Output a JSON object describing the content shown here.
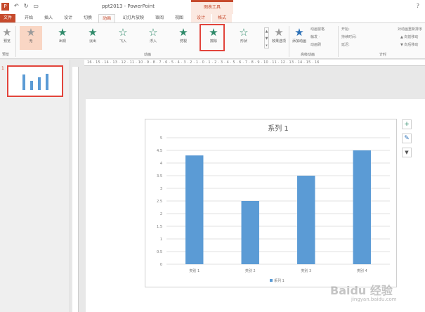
{
  "titlebar": {
    "window_title": "ppt2013 - PowerPoint",
    "context_header": "图表工具",
    "help": "?",
    "qat": {
      "app": "P",
      "undo": "↶",
      "redo": "↻",
      "present": "▭"
    }
  },
  "tabs": [
    {
      "label": "文件"
    },
    {
      "label": "开始"
    },
    {
      "label": "插入"
    },
    {
      "label": "设计"
    },
    {
      "label": "切换"
    },
    {
      "label": "动画"
    },
    {
      "label": "幻灯片放映"
    },
    {
      "label": "审阅"
    },
    {
      "label": "视图"
    },
    {
      "label": "设计"
    },
    {
      "label": "格式"
    }
  ],
  "ribbon": {
    "preview": {
      "label": "预览",
      "group": "预览"
    },
    "animations": [
      {
        "label": "无"
      },
      {
        "label": "出现"
      },
      {
        "label": "淡出"
      },
      {
        "label": "飞入"
      },
      {
        "label": "浮入"
      },
      {
        "label": "劈裂"
      },
      {
        "label": "擦除"
      },
      {
        "label": "形状"
      }
    ],
    "effect_options": "效果选项",
    "animation_group": "动画",
    "add_animation": "添加动画",
    "adv": [
      "动画窗格",
      "触发 ·",
      "动画刷"
    ],
    "adv_group": "高级动画",
    "timing": [
      "开始:",
      "持续时间:",
      "延迟:"
    ],
    "reorder": [
      "对动画重新排序",
      "▲ 向前移动",
      "▼ 向后移动"
    ],
    "timing_group": "计时"
  },
  "ruler_text": "16 · 15 · 14 · 13 · 12 · 11 · 10 · 9 · 8 · 7 · 6 · 5 · 4 · 3 · 2 · 1 · 0 · 1 · 2 · 3 · 4 · 5 · 6 · 7 · 8 · 9 · 10 · 11 · 12 · 13 · 14 · 15 · 16",
  "slide_number": "1",
  "side_buttons": {
    "add": "+",
    "brush": "✎",
    "filter": "▼"
  },
  "chart_data": {
    "type": "bar",
    "title": "系列 1",
    "categories": [
      "类别 1",
      "类别 2",
      "类别 3",
      "类别 4"
    ],
    "series": [
      {
        "name": "系列 1",
        "values": [
          4.3,
          2.5,
          3.5,
          4.5
        ],
        "color": "#5b9bd5"
      }
    ],
    "ylim": [
      0,
      5
    ],
    "yticks": [
      "0",
      "0.5",
      "1",
      "1.5",
      "2",
      "2.5",
      "3",
      "3.5",
      "4",
      "4.5",
      "5"
    ],
    "grid": true,
    "legend": "bottom"
  },
  "watermark": {
    "brand": "Baidu 经验",
    "url": "jingyan.baidu.com"
  }
}
